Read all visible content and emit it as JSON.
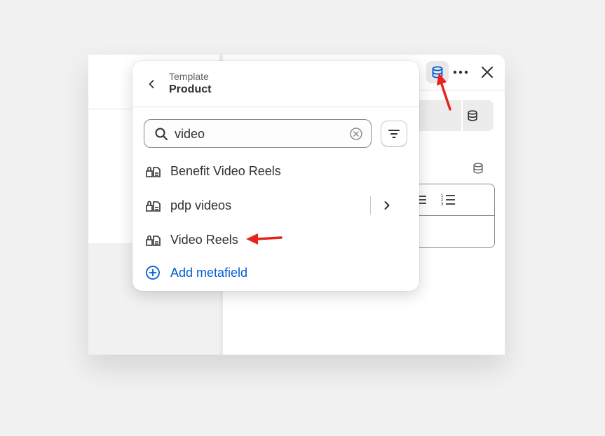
{
  "popover": {
    "breadcrumb_parent": "Template",
    "breadcrumb_title": "Product",
    "search": {
      "value": "video"
    },
    "items": [
      {
        "label": "Benefit Video Reels"
      },
      {
        "label": "pdp videos"
      },
      {
        "label": "Video Reels"
      }
    ],
    "add_label": "Add metafield"
  },
  "icons": {
    "back": "chevron-left-icon",
    "search": "search-icon",
    "clear": "clear-circle-icon",
    "filter": "filter-icon",
    "metafield": "metafield-icon",
    "chevron": "chevron-right-icon",
    "add": "plus-circle-icon",
    "dynamic_source": "database-icon",
    "more": "more-horizontal-icon",
    "close": "close-icon"
  },
  "colors": {
    "accent": "#005bd3",
    "annotation": "#e8231c"
  }
}
